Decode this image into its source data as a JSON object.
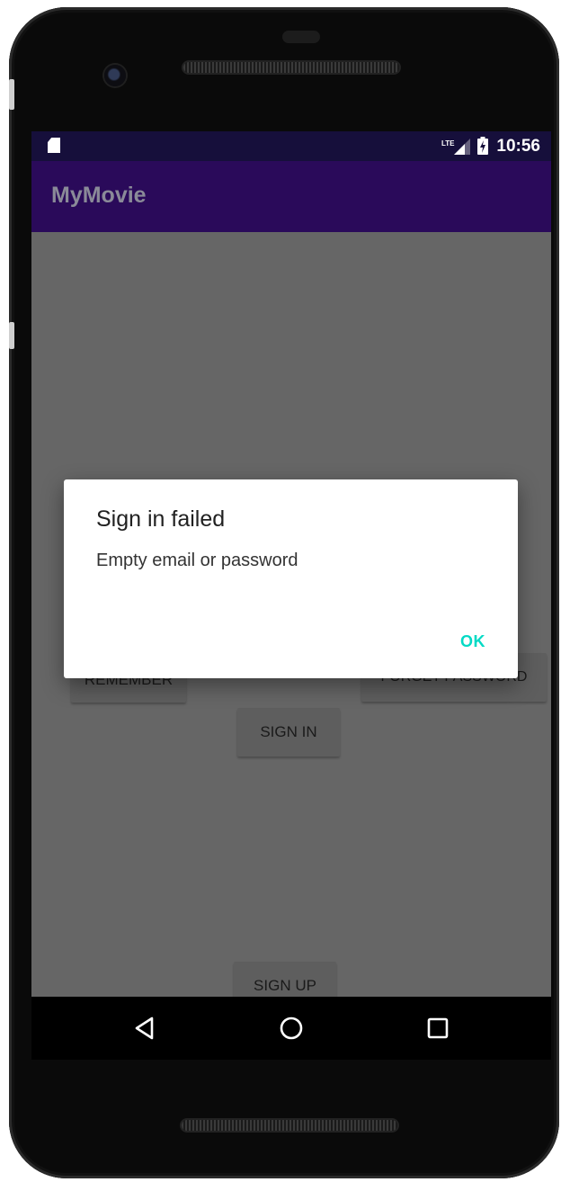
{
  "status_bar": {
    "time": "10:56",
    "network": "LTE"
  },
  "app_bar": {
    "title": "MyMovie"
  },
  "background": {
    "remember_button": "REMEMBER",
    "forget_password_button": "FORGET PASSWORD",
    "sign_in_button": "SIGN IN",
    "sign_up_button": "SIGN UP"
  },
  "dialog": {
    "title": "Sign in failed",
    "message": "Empty email or password",
    "ok_label": "OK"
  },
  "colors": {
    "status_bar": "#160f3b",
    "app_bar": "#2a0a5a",
    "dialog_button": "#03dac5",
    "scrim": "#666666"
  },
  "icons": {
    "status": [
      "sd-card-icon",
      "lte-signal-icon",
      "battery-charging-icon"
    ],
    "nav": [
      "back-icon",
      "home-icon",
      "recents-icon"
    ]
  }
}
